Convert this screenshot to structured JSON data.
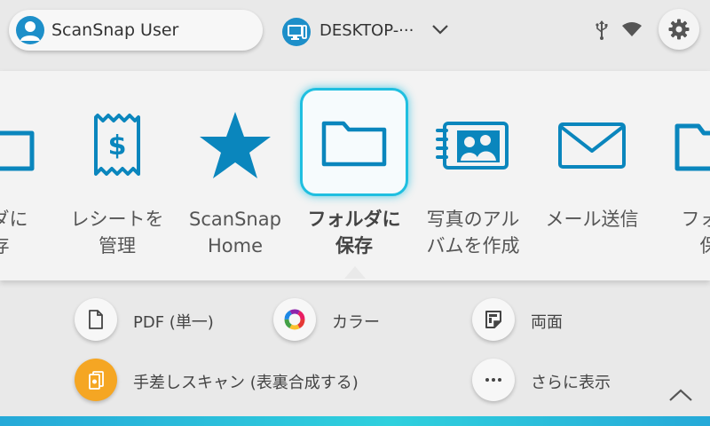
{
  "header": {
    "user_name": "ScanSnap User",
    "device_name": "DESKTOP-···"
  },
  "profiles": [
    {
      "label": "ルダに\n存",
      "icon": "folder-icon"
    },
    {
      "label": "レシートを\n管理",
      "icon": "receipt-icon"
    },
    {
      "label": "ScanSnap\nHome",
      "icon": "star-icon"
    },
    {
      "label": "フォルダに\n保存",
      "icon": "folder-icon",
      "selected": true
    },
    {
      "label": "写真のアル\nバムを作成",
      "icon": "photo-album-icon"
    },
    {
      "label": "メール送信",
      "icon": "mail-icon"
    },
    {
      "label": "フォル\n保",
      "icon": "folder-icon"
    }
  ],
  "settings": {
    "file_format": "PDF (単一)",
    "color_mode": "カラー",
    "sides": "両面",
    "manual_feed": "手差しスキャン (表裏合成する)",
    "more": "さらに表示"
  },
  "colors": {
    "accent": "#1d8fc9",
    "icon_blue": "#0a86bd",
    "selected_glow": "#1fbfe0",
    "manual_feed_orange": "#f5a623"
  }
}
